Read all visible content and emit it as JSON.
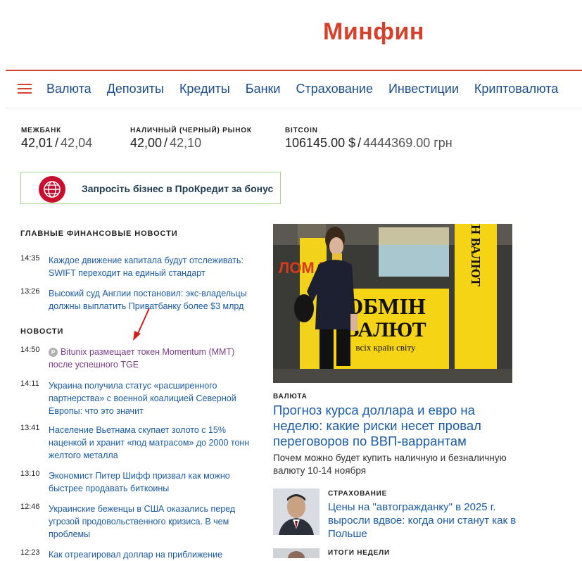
{
  "header": {
    "logo": "Минфин"
  },
  "nav": {
    "items": [
      "Валюта",
      "Депозиты",
      "Кредиты",
      "Банки",
      "Страхование",
      "Инвестиции",
      "Криптовалюта"
    ]
  },
  "rates": [
    {
      "label": "МЕЖБАНК",
      "buy": "42,01",
      "sell": "42,04"
    },
    {
      "label": "НАЛИЧНЫЙ (ЧЕРНЫЙ) РЫНОК",
      "buy": "42,00",
      "sell": "42,10"
    },
    {
      "label": "BITCOIN",
      "buy": "106145.00 $",
      "sell": "4444369.00 грн"
    }
  ],
  "promo": {
    "text": "Запросіть бізнес в ПроКредит за бонус"
  },
  "main_news": {
    "title": "ГЛАВНЫЕ ФИНАНСОВЫЕ НОВОСТИ",
    "items": [
      {
        "time": "14:35",
        "headline": "Каждое движение капитала будут отслеживать: SWIFT переходит на единый стандарт"
      },
      {
        "time": "13:26",
        "headline": "Высокий суд Англии постановил: экс-владельцы должны выплатить Приватбанку более $3 млрд"
      }
    ]
  },
  "news": {
    "title": "НОВОСТИ",
    "badge": "P",
    "items": [
      {
        "time": "14:50",
        "headline": "Bitunix размещает токен Momentum (MMT) после успешного TGE"
      },
      {
        "time": "14:11",
        "headline": "Украина получила статус «расширенного партнерства» с военной коалицией Северной Европы: что это значит"
      },
      {
        "time": "13:41",
        "headline": "Население Вьетнама скупает золото с 15% наценкой и хранит «под матрасом» до 2000 тонн желтого металла"
      },
      {
        "time": "13:10",
        "headline": "Экономист Питер Шифф призвал как можно быстрее продавать биткоины"
      },
      {
        "time": "12:46",
        "headline": "Украинские беженцы в США оказались перед угрозой продовольственного кризиса. В чем проблемы"
      },
      {
        "time": "12:23",
        "headline": "Как отреагировал доллар на приближение"
      }
    ]
  },
  "featured": {
    "photo_sign_main": "ОБМІН",
    "photo_sign_main2": "ВАЛЮТ",
    "photo_sign_sub": "всіх країн світу",
    "photo_sign_vertical": "ОБМІН ВАЛЮТ",
    "photo_sign_left": "ЛОМ ГРД",
    "category": "ВАЛЮТА",
    "title": "Прогноз курса доллара и евро на неделю: какие риски несет провал переговоров по ВВП-варрантам",
    "lead": "Почем можно будет купить наличную и безналичную валюту 10-14 ноября"
  },
  "side_articles": [
    {
      "category": "СТРАХОВАНИЕ",
      "title": "Цены на \"автогражданку\" в 2025 г. выросли вдвое: когда они станут как в Польше"
    },
    {
      "category": "ИТОГИ НЕДЕЛИ",
      "title": ""
    }
  ],
  "colors": {
    "brand_red": "#d7412b",
    "link_blue": "#1a5ba6",
    "visited_purple": "#7a3b8a",
    "promo_border": "#a7d48a"
  }
}
